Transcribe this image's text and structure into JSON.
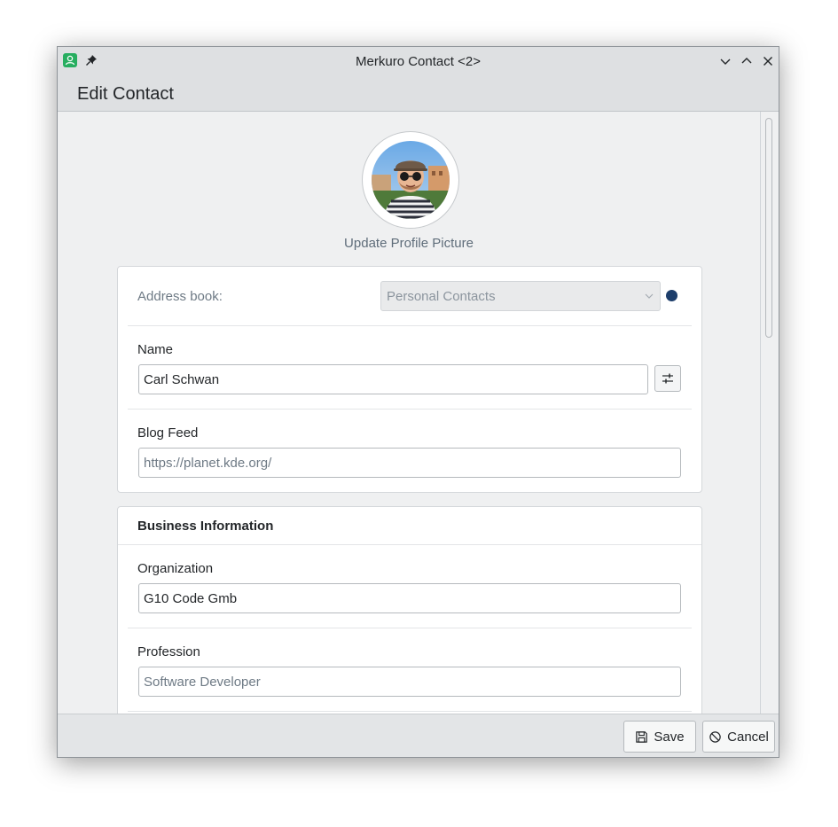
{
  "window": {
    "title": "Merkuro Contact <2>",
    "app_icon": "contact-app-icon",
    "controls": [
      "minimize",
      "maximize",
      "close"
    ]
  },
  "header": {
    "title": "Edit Contact"
  },
  "profile": {
    "update_label": "Update Profile Picture"
  },
  "general_card": {
    "address_book_label": "Address book:",
    "address_book_value": "Personal Contacts",
    "address_book_color": "#1d3e6b",
    "name_label": "Name",
    "name_value": "Carl Schwan",
    "blog_label": "Blog Feed",
    "blog_placeholder": "https://planet.kde.org/"
  },
  "business_card": {
    "title": "Business Information",
    "organization_label": "Organization",
    "organization_value": "G10 Code Gmb",
    "profession_label": "Profession",
    "profession_placeholder": "Software Developer"
  },
  "footer": {
    "save_label": "Save",
    "cancel_label": "Cancel"
  },
  "colors": {
    "accent": "#3daee9",
    "background": "#eff0f1",
    "header": "#dee0e2"
  }
}
